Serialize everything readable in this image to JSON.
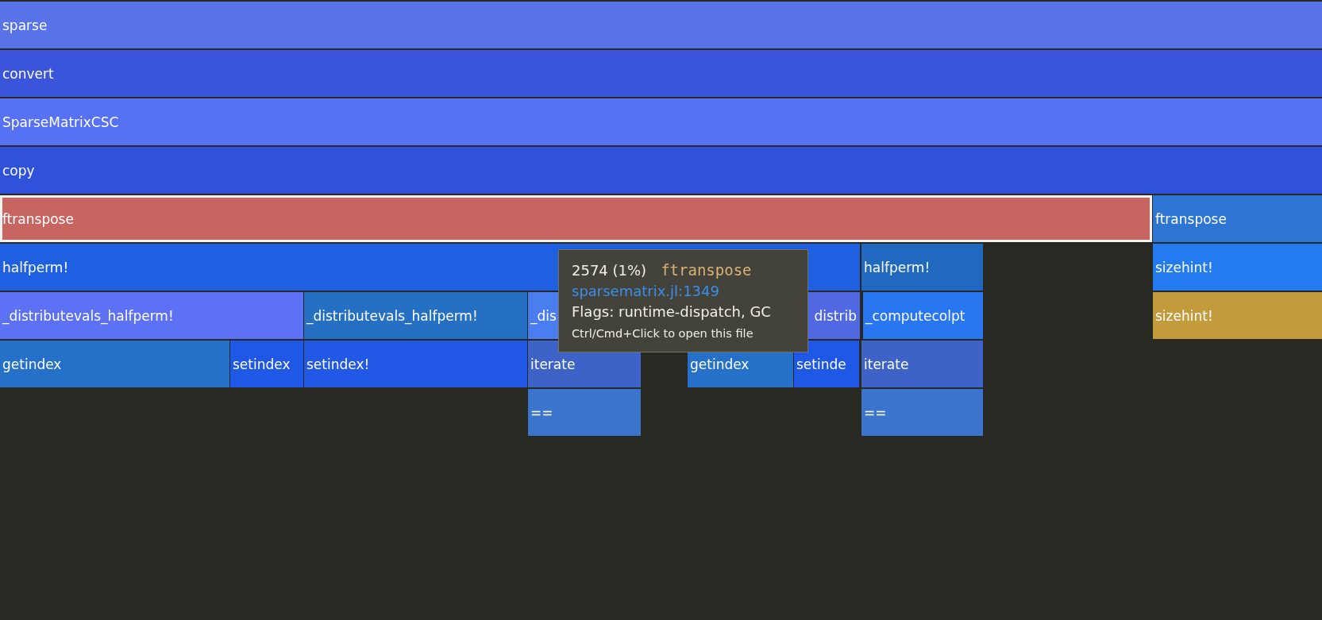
{
  "rows": [
    {
      "frames": [
        {
          "name": "sparse",
          "color": "#5873e8",
          "selected": false
        }
      ]
    },
    {
      "frames": [
        {
          "name": "convert",
          "color": "#3a54dc",
          "selected": false
        }
      ]
    },
    {
      "frames": [
        {
          "name": "SparseMatrixCSC",
          "color": "#5771f5",
          "selected": false
        }
      ]
    },
    {
      "frames": [
        {
          "name": "copy",
          "color": "#2f51dc",
          "selected": false
        }
      ]
    },
    {
      "frames": [
        {
          "name": "ftranspose",
          "color": "#c76660",
          "selected": true
        },
        {
          "name": "ftranspose",
          "color": "#2e74d3",
          "selected": false
        }
      ]
    },
    {
      "frames": [
        {
          "name": "halfperm!",
          "color": "#1f60e2",
          "selected": false
        },
        {
          "name": "halfperm!",
          "color": "#2169c0",
          "selected": false
        },
        {
          "name": "sizehint!",
          "color": "#247bf0",
          "selected": false
        }
      ]
    },
    {
      "frames": [
        {
          "name": "_distributevals_halfperm!",
          "color": "#5c71f3",
          "selected": false
        },
        {
          "name": "_distributevals_halfperm!",
          "color": "#2670c4",
          "selected": false
        },
        {
          "name": "_dis",
          "color": "#4a7ef0",
          "selected": false
        },
        {
          "name": "distrib",
          "color": "#5068e2",
          "selected": false
        },
        {
          "name": "_computecolpt",
          "color": "#2877f0",
          "selected": false
        },
        {
          "name": "sizehint!",
          "color": "#c49b3c",
          "selected": false
        }
      ]
    },
    {
      "frames": [
        {
          "name": "getindex",
          "color": "#2570c8",
          "selected": false
        },
        {
          "name": "setindex",
          "color": "#1f58e6",
          "selected": false
        },
        {
          "name": "setindex!",
          "color": "#2159e6",
          "selected": false
        },
        {
          "name": "iterate",
          "color": "#3d63c8",
          "selected": false
        },
        {
          "name": "getindex",
          "color": "#2570c8",
          "selected": false
        },
        {
          "name": "setinde",
          "color": "#1f58e6",
          "selected": false
        },
        {
          "name": "iterate",
          "color": "#3d63c8",
          "selected": false
        }
      ]
    },
    {
      "frames": [
        {
          "name": "==",
          "color": "#3a74cc",
          "selected": false
        },
        {
          "name": "==",
          "color": "#3a74cc",
          "selected": false
        }
      ]
    }
  ],
  "tooltip": {
    "count": "2574 (1%)",
    "function": "ftranspose",
    "file": "sparsematrix.jl:1349",
    "flags": "Flags: runtime-dispatch, GC",
    "hint": "Ctrl/Cmd+Click to open this file"
  }
}
